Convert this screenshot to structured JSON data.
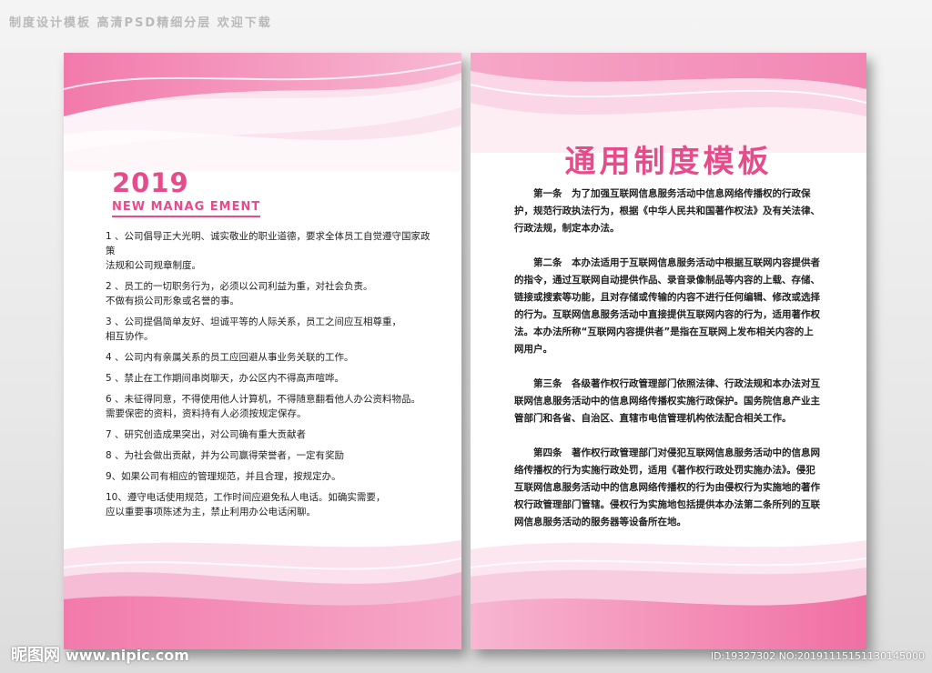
{
  "banner": "制度设计模板 高清PSD精细分层 欢迎下载",
  "left_page": {
    "year": "2019",
    "subtitle": "NEW MANAG EMENT",
    "rules": [
      [
        "1 、公司倡导正大光明、诚实敬业的职业道德，要求全体员工自觉遵守国家政策",
        "法规和公司规章制度。"
      ],
      [
        "2 、员工的一切职务行为，必须以公司利益为重，对社会负责。",
        "不做有损公司形象或名誉的事。"
      ],
      [
        "3 、公司提倡简单友好、坦诚平等的人际关系，员工之间应互相尊重，",
        "相互协作。"
      ],
      [
        "4 、公司内有亲属关系的员工应回避从事业务关联的工作。"
      ],
      [
        "5 、禁止在工作期间串岗聊天，办公区内不得高声喧哗。"
      ],
      [
        "6 、未征得同意，不得使用他人计算机，不得随意翻看他人办公资料物品。",
        "需要保密的资料，资料持有人必须按规定保存。"
      ],
      [
        "7 、研究创造成果突出，对公司确有重大贡献者"
      ],
      [
        "8 、为社会做出贡献，并为公司赢得荣誉者，一定有奖励"
      ],
      [
        "9、如果公司有相应的管理规范，并且合理，按规定办。"
      ],
      [
        "10、遵守电话使用规范，工作时间应避免私人电话。如确实需要，",
        "应以重要事项陈述为主，禁止利用办公电话闲聊。"
      ]
    ]
  },
  "right_page": {
    "title": "通用制度模板",
    "articles": [
      [
        "第一条　为了加强互联网信息服务活动中信息网络传播权的行政保",
        "护，规范行政执法行为，根据《中华人民共和国著作权法》及有关法律、",
        "行政法规，制定本办法。"
      ],
      [
        "第二条　本办法适用于互联网信息服务活动中根据互联网内容提供者",
        "的指令，通过互联网自动提供作品、录音录像制品等内容的上载、存储、",
        "链接或搜索等功能，且对存储或传输的内容不进行任何编辑、修改或选择",
        "的行为。互联网信息服务活动中直接提供互联网内容的行为，适用著作权",
        "法。本办法所称“互联网内容提供者”是指在互联网上发布相关内容的上",
        "网用户。"
      ],
      [
        "第三条　各级著作权行政管理部门依照法律、行政法规和本办法对互",
        "联网信息服务活动中的信息网络传播权实施行政保护。国务院信息产业主",
        "管部门和各省、自治区、直辖市电信管理机构依法配合相关工作。"
      ],
      [
        "第四条　著作权行政管理部门对侵犯互联网信息服务活动中的信息网",
        "络传播权的行为实施行政处罚，适用《著作权行政处罚实施办法》。侵犯",
        "互联网信息服务活动中的信息网络传播权的行为由侵权行为实施地的著作",
        "权行政管理部门管辖。侵权行为实施地包括提供本办法第二条所列的互联",
        "网信息服务活动的服务器等设备所在地。"
      ]
    ]
  },
  "watermark": {
    "logo": "昵图网",
    "url": "www.nipic.com",
    "id": "ID:19327302 NO:20191115151130145000"
  },
  "colors": {
    "accent": "#e54c8b",
    "pink_light": "#f9c7dc",
    "pink_mid": "#ef7fac"
  }
}
